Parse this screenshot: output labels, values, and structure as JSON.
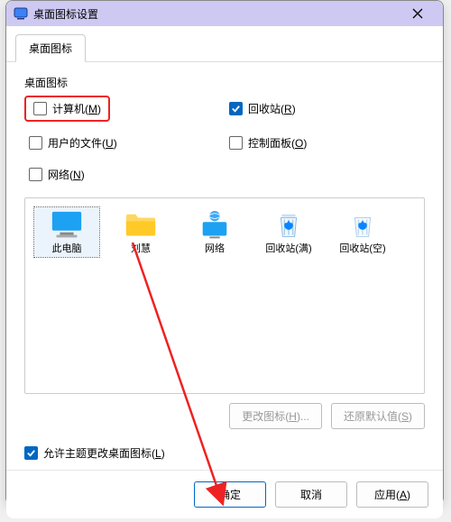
{
  "window": {
    "title": "桌面图标设置"
  },
  "tabs": {
    "tab0": "桌面图标"
  },
  "group": {
    "label": "桌面图标"
  },
  "checkboxes": {
    "computer": {
      "base": "计算机",
      "accel": "M",
      "checked": false
    },
    "recyclebin": {
      "base": "回收站",
      "accel": "R",
      "checked": true
    },
    "userfiles": {
      "base": "用户的文件",
      "accel": "U",
      "checked": false
    },
    "controlpanel": {
      "base": "控制面板",
      "accel": "O",
      "checked": false
    },
    "network": {
      "base": "网络",
      "accel": "N",
      "checked": false
    }
  },
  "preview": {
    "items": {
      "thispc": "此电脑",
      "userfolder": "刘慧",
      "network": "网络",
      "rb_full": "回收站(满)",
      "rb_empty": "回收站(空)"
    }
  },
  "panel_buttons": {
    "change_icon": {
      "base": "更改图标",
      "accel": "H",
      "tail": "..."
    },
    "restore_default": {
      "base": "还原默认值",
      "accel": "S"
    }
  },
  "theme_checkbox": {
    "base": "允许主题更改桌面图标",
    "accel": "L",
    "checked": true
  },
  "footer": {
    "ok": "确定",
    "cancel": "取消",
    "apply": {
      "base": "应用",
      "accel": "A"
    }
  },
  "colors": {
    "accent": "#0067c0",
    "titlebar": "#cdc9f2",
    "highlight": "#e22"
  }
}
